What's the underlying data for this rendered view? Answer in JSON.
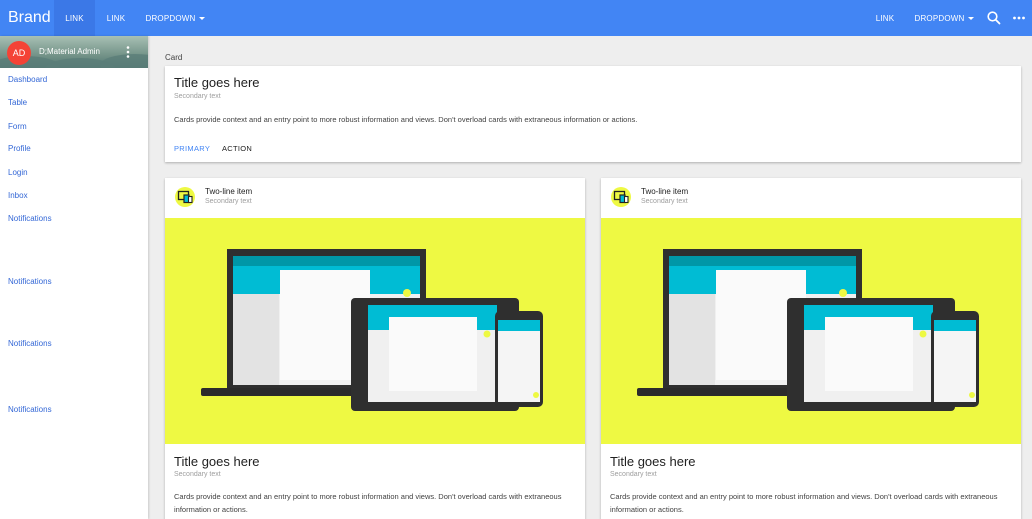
{
  "navbar": {
    "brand": "Brand",
    "link_active": "LINK",
    "link": "LINK",
    "dropdown": "DROPDOWN",
    "right_link": "LINK",
    "right_dropdown": "DROPDOWN",
    "icons": [
      "search-icon",
      "more-horiz-icon"
    ],
    "color": "#4285f4"
  },
  "sidebar": {
    "avatar_initials": "AD",
    "admin_name": "D;Material Admin",
    "items": [
      {
        "label": "Dashboard"
      },
      {
        "label": "Table"
      },
      {
        "label": "Form"
      },
      {
        "label": "Profile"
      },
      {
        "label": "Login"
      },
      {
        "label": "Inbox"
      },
      {
        "label": "Notifications"
      },
      {
        "label": "Notifications"
      },
      {
        "label": "Notifications"
      },
      {
        "label": "Notifications"
      }
    ]
  },
  "main": {
    "section_title": "Card",
    "top_card": {
      "title": "Title goes here",
      "subtitle": "Secondary text",
      "text": "Cards provide context and an entry point to more robust information and views. Don't overload cards with extraneous information or actions.",
      "primary_label": "PRIMARY",
      "action_label": "ACTION"
    },
    "media_cards": [
      {
        "item_title": "Two-line item",
        "item_sub": "Secondary text",
        "title": "Title goes here",
        "subtitle": "Secondary text",
        "text_line1": "Cards provide context and an entry point to more robust information and views. Don't overload cards with extraneous",
        "text_line2": "information or actions."
      },
      {
        "item_title": "Two-line item",
        "item_sub": "Secondary text",
        "title": "Title goes here",
        "subtitle": "Secondary text",
        "text_line1": "Cards provide context and an entry point to more robust information and views. Don't overload cards with extraneous",
        "text_line2": "information or actions."
      }
    ],
    "media_color": "#eef943"
  }
}
